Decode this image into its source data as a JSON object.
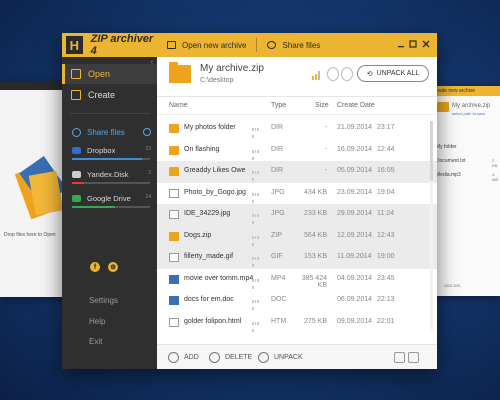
{
  "app": {
    "logo_letter": "H",
    "title": "ZIP archiver 4",
    "accent": "#ecb433"
  },
  "sidebar": {
    "open": "Open",
    "create": "Create",
    "share_files": "Share files",
    "clouds": [
      {
        "name": "Dropbox",
        "count": "23",
        "fill": 0.9,
        "color": "#3a8fd8"
      },
      {
        "name": "Yandex.Disk",
        "count": "2",
        "fill": 0.15,
        "color": "#e53935"
      },
      {
        "name": "Google Drive",
        "count": "14",
        "fill": 0.55,
        "color": "#34a853"
      }
    ],
    "settings": "Settings",
    "help": "Help",
    "exit": "Exit",
    "social": [
      "f",
      "⊕"
    ]
  },
  "topbar": {
    "open_new": "Open new archive",
    "share": "Share files"
  },
  "archive": {
    "name": "My archive.zip",
    "path": "C:\\desktop",
    "unpack_all": "UNPACK ALL"
  },
  "columns": {
    "name": "Name",
    "type": "Type",
    "size": "Size",
    "date": "Create Date"
  },
  "files": [
    {
      "name": "My photos folder",
      "type": "DIR",
      "size": "-",
      "date": "21.09.2014",
      "time": "23:17",
      "icon": "dir",
      "sel": false
    },
    {
      "name": "On flashing",
      "type": "DIR",
      "size": "-",
      "date": "16.09.2014",
      "time": "12:44",
      "icon": "dir",
      "sel": false
    },
    {
      "name": "Greaddy Likes Owe",
      "type": "DIR",
      "size": "-",
      "date": "05.09.2014",
      "time": "16:05",
      "icon": "dir",
      "sel": true
    },
    {
      "name": "Photo_by_Gogo.jpg",
      "type": "JPG",
      "size": "434 KB",
      "date": "23.09.2014",
      "time": "19:04",
      "icon": "file",
      "sel": false
    },
    {
      "name": "IDE_34229.jpg",
      "type": "JPG",
      "size": "233 KB",
      "date": "29.09.2014",
      "time": "11:24",
      "icon": "file",
      "sel": true
    },
    {
      "name": "Dogs.zip",
      "type": "ZIP",
      "size": "564 KB",
      "date": "12.09.2014",
      "time": "12:43",
      "icon": "zip",
      "sel": true
    },
    {
      "name": "fillerty_made.gif",
      "type": "GIF",
      "size": "153 KB",
      "date": "11.09.2014",
      "time": "19:00",
      "icon": "file",
      "sel": true
    },
    {
      "name": "movie over tomm.mp4",
      "type": "MP4",
      "size": "385 424 KB",
      "date": "04.09.2014",
      "time": "23:45",
      "icon": "media",
      "sel": false
    },
    {
      "name": "docs for em.doc",
      "type": "DOC",
      "size": "",
      "date": "06.09.2014",
      "time": "22:13",
      "icon": "media",
      "sel": false
    },
    {
      "name": "golder folipon.html",
      "type": "HTM",
      "size": "275 KB",
      "date": "09.09.2014",
      "time": "22:01",
      "icon": "file",
      "sel": false
    }
  ],
  "footer": {
    "add": "ADD",
    "delete": "DELETE",
    "unpack": "UNPACK"
  },
  "bg_left": {
    "drop_text": "Drop files here to Open"
  },
  "bg_right": {
    "topbar": "Create new archive",
    "title": "My archive.zip",
    "sub": "select path to save",
    "rows": [
      {
        "name": "My folder",
        "size": ""
      },
      {
        "name": "Document.txt",
        "size": "2 KB"
      },
      {
        "name": "Media.mp3",
        "size": "4 MB"
      }
    ],
    "foot": "ADD   DEL"
  }
}
